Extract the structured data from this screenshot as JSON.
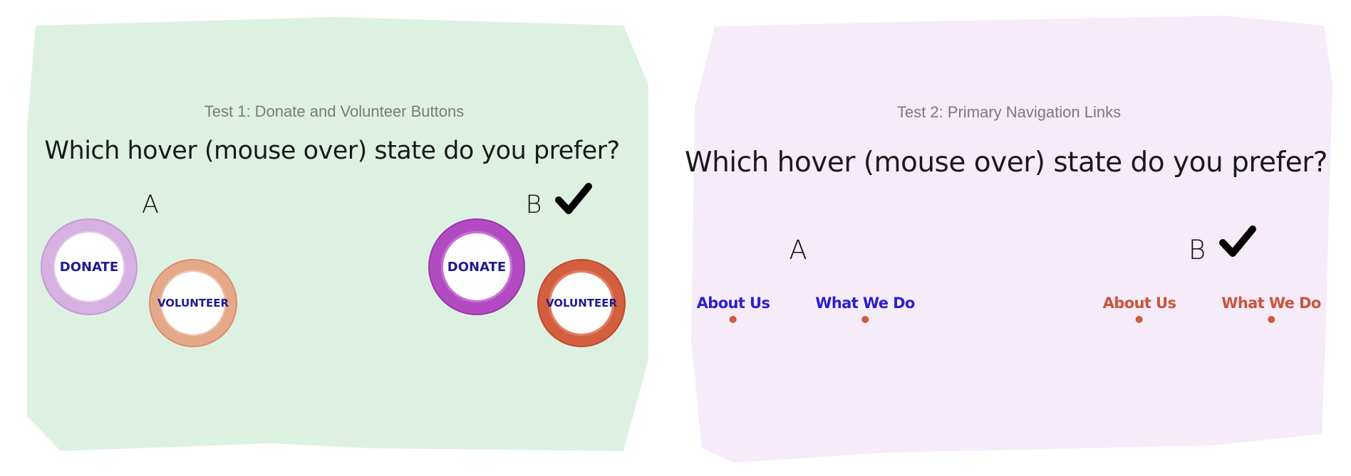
{
  "colors": {
    "panel1_bg": "#ddf1e3",
    "panel2_bg": "#f6ebf8",
    "option_a_link": "#2a1fcf",
    "option_b_link": "#c8553a",
    "link_dot": "#cf5a3c",
    "donate_text": "#1f1c8f"
  },
  "test1": {
    "subtitle": "Test 1: Donate and Volunteer Buttons",
    "question": "Which hover (mouse over) state do you prefer?",
    "option_a_label": "A",
    "option_b_label": "B",
    "selected_option": "B",
    "option_a": {
      "donate": "DONATE",
      "volunteer": "VOLUNTEER"
    },
    "option_b": {
      "donate": "DONATE",
      "volunteer": "VOLUNTEER"
    }
  },
  "test2": {
    "subtitle": "Test 2: Primary Navigation Links",
    "question": "Which hover (mouse over) state do you prefer?",
    "option_a_label": "A",
    "option_b_label": "B",
    "selected_option": "B",
    "option_a": {
      "about": "About Us",
      "what": "What We Do"
    },
    "option_b": {
      "about": "About Us",
      "what": "What We Do"
    }
  }
}
